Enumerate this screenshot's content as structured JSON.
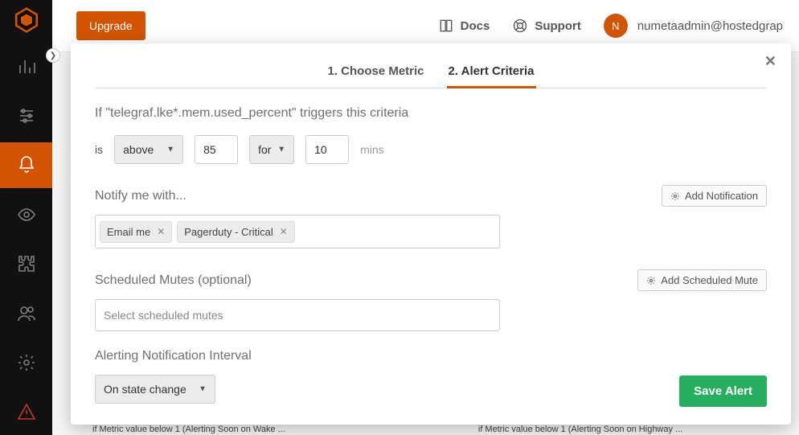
{
  "topbar": {
    "upgrade": "Upgrade",
    "docs": "Docs",
    "support": "Support",
    "avatar_initial": "N",
    "username": "numetaadmin@hostedgrap"
  },
  "modal": {
    "step1": "1. Choose Metric",
    "step2": "2. Alert Criteria",
    "criteria_sentence": "If \"telegraf.lke*.mem.used_percent\" triggers this criteria",
    "is_label": "is",
    "comparator": "above",
    "threshold": "85",
    "for_label": "for",
    "duration": "10",
    "mins_label": "mins",
    "notify_title": "Notify me with...",
    "add_notification": "Add Notification",
    "chips": {
      "email": "Email me",
      "pd": "Pagerduty - Critical"
    },
    "mutes_title": "Scheduled Mutes (optional)",
    "add_mute": "Add Scheduled Mute",
    "mutes_placeholder": "Select scheduled mutes",
    "interval_title": "Alerting Notification Interval",
    "interval_value": "On state change",
    "save": "Save Alert",
    "close": "✕"
  },
  "backdrop": {
    "left_hint": "if   Metric value below 1  (Alerting Soon on Wake ...",
    "right_hint": "if   Metric value below 1  (Alerting Soon on Highway ..."
  }
}
